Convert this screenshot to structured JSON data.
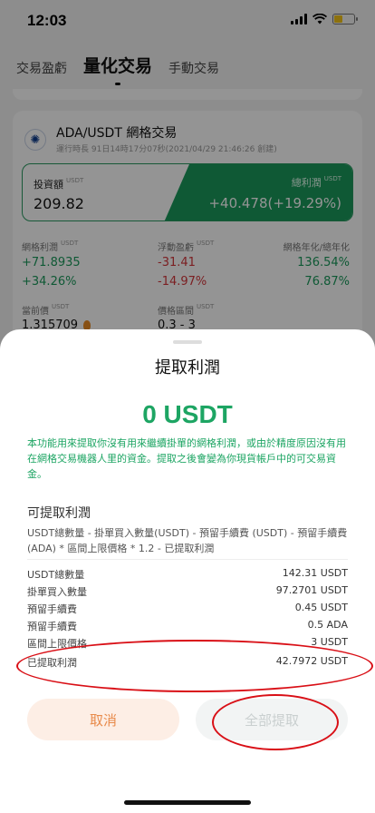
{
  "status": {
    "time": "12:03"
  },
  "tabs": [
    {
      "label": "交易盈虧"
    },
    {
      "label": "量化交易"
    },
    {
      "label": "手動交易"
    }
  ],
  "card": {
    "coin_icon": "cardano-icon",
    "title": "ADA/USDT 網格交易",
    "runtime": "運行時長 91日14時17分07秒(2021/04/29 21:46:26 創建)",
    "investment_label": "投資額",
    "investment_unit": "USDT",
    "investment_value": "209.82",
    "total_profit_label": "總利潤",
    "total_profit_unit": "USDT",
    "total_profit_value": "+40.478(+19.29%)",
    "grid_profit_label": "網格利潤",
    "grid_profit_unit": "USDT",
    "grid_profit_value": "+71.8935",
    "grid_profit_pct": "+34.26%",
    "floating_label": "浮動盈虧",
    "floating_unit": "USDT",
    "floating_value": "-31.41",
    "floating_pct": "-14.97%",
    "annual_label": "網格年化/總年化",
    "annual_grid": "136.54%",
    "annual_total": "76.87%",
    "price_label": "當前價",
    "price_unit": "USDT",
    "price_value": "1.315709",
    "range_label": "價格區間",
    "range_unit": "USDT",
    "range_value": "0.3 - 3"
  },
  "sheet": {
    "title": "提取利潤",
    "amount": "0 USDT",
    "description": "本功能用來提取你沒有用來繼續掛單的網格利潤，或由於精度原因沒有用在網格交易機器人里的資金。提取之後會變為你現貨帳戶中的可交易資金。",
    "section_title": "可提取利潤",
    "formula": "USDT總數量 - 掛單買入數量(USDT) - 預留手續費 (USDT) - 預留手續費 (ADA) * 區間上限價格 * 1.2 - 已提取利潤",
    "rows": [
      {
        "label": "USDT總數量",
        "value": "142.31 USDT"
      },
      {
        "label": "掛單買入數量",
        "value": "97.2701 USDT"
      },
      {
        "label": "預留手續費",
        "value": "0.45 USDT"
      },
      {
        "label": "預留手續費",
        "value": "0.5 ADA"
      },
      {
        "label": "區間上限價格",
        "value": "3 USDT"
      },
      {
        "label": "已提取利潤",
        "value": "42.7972 USDT"
      }
    ],
    "cancel_label": "取消",
    "withdraw_all_label": "全部提取"
  },
  "colors": {
    "accent_green": "#1da563",
    "loss_red": "#d5363c",
    "annotation_red": "#d90f16",
    "cancel_orange": "#e88a4a"
  }
}
